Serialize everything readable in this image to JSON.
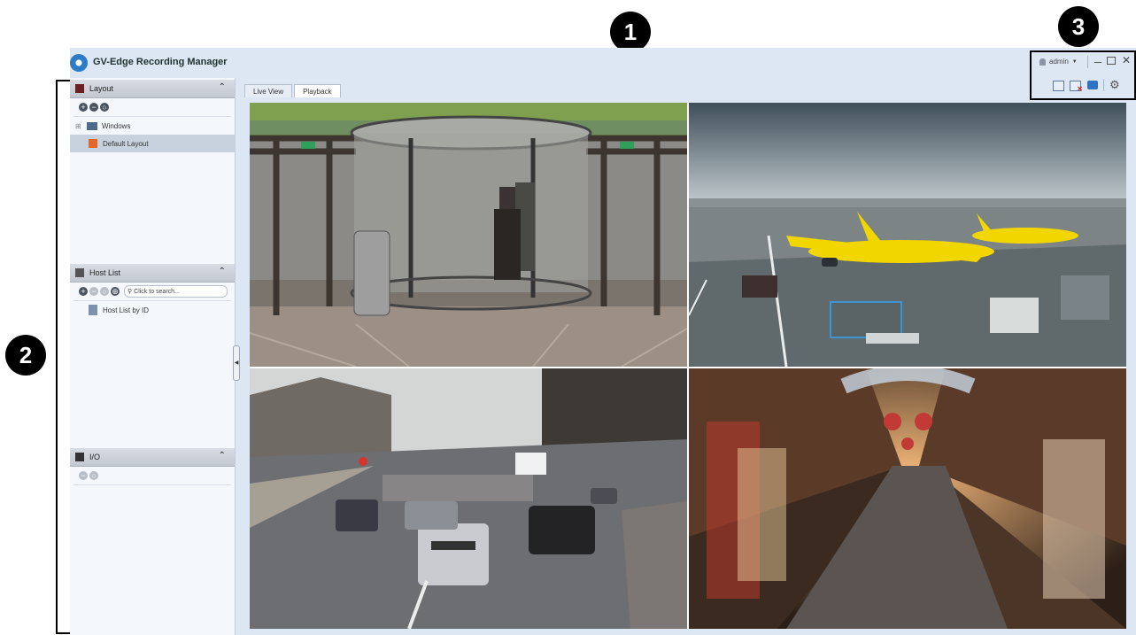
{
  "app": {
    "title": "GV-Edge Recording Manager"
  },
  "callouts": [
    "1",
    "2",
    "3"
  ],
  "tabs": [
    {
      "label": "Live View"
    },
    {
      "label": "Playback"
    }
  ],
  "user": {
    "name": "admin"
  },
  "panels": {
    "layout": {
      "title": "Layout",
      "items": [
        "Windows",
        "Default Layout"
      ]
    },
    "host_list": {
      "title": "Host List",
      "search_placeholder": "Click to search...",
      "items": [
        "Host List by ID"
      ]
    },
    "io": {
      "title": "I/O"
    }
  },
  "cameras": [
    {
      "scene": "revolving-door-entrance"
    },
    {
      "scene": "airport-apron-yellow-jets"
    },
    {
      "scene": "city-street-traffic"
    },
    {
      "scene": "shopping-arcade-night"
    }
  ],
  "colors": {
    "accent": "#2d7bc4",
    "window_bg": "#dde7f3",
    "callout": "#000000"
  }
}
